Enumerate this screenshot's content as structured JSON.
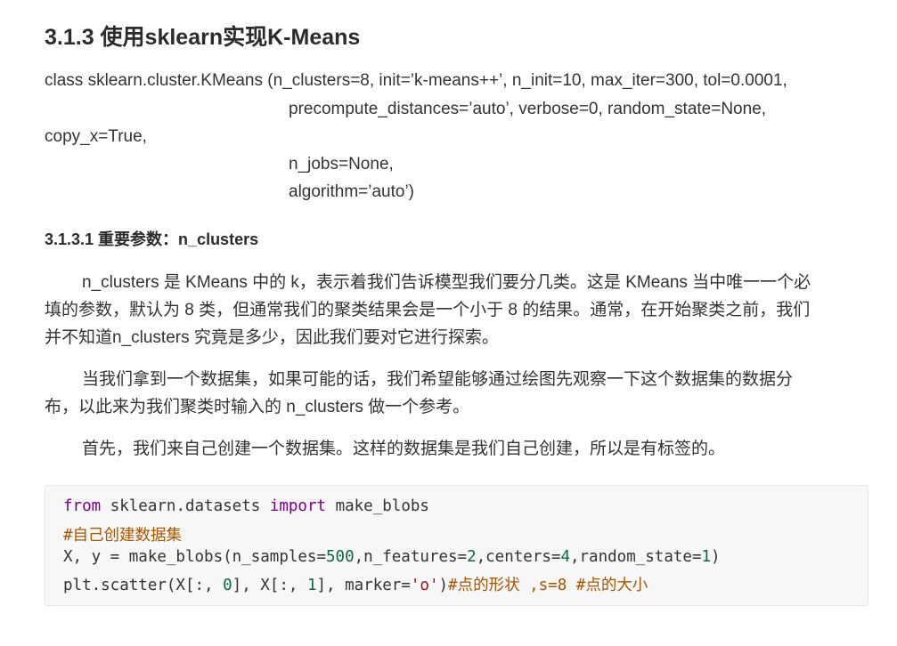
{
  "heading": "3.1.3 使用sklearn实现K-Means",
  "signature": {
    "line1": "class sklearn.cluster.KMeans (n_clusters=8, init=’k-means++’, n_init=10, max_iter=300, tol=0.0001,",
    "line2": "precompute_distances=’auto’, verbose=0, random_state=None,",
    "line3": "copy_x=True,",
    "line4": "n_jobs=None,",
    "line5": "algorithm=’auto’)"
  },
  "subheading": "3.1.3.1 重要参数：n_clusters",
  "paragraphs": {
    "p1": [
      "n_clusters 是 KMeans 中的 k，表示着我们告诉模型我们要分几类。这是 KMeans 当中唯一一个必",
      "填的参数，默认为 8 类，但通常我们的聚类结果会是一个小于 8 的结果。通常，在开始聚类之前，我们",
      "并不知道n_clusters 究竟是多少，因此我们要对它进行探索。"
    ],
    "p2": [
      "当我们拿到一个数据集，如果可能的话，我们希望能够通过绘图先观察一下这个数据集的数据分",
      "布，以此来为我们聚类时输入的 n_clusters 做一个参考。"
    ],
    "p3": [
      "首先，我们来自己创建一个数据集。这样的数据集是我们自己创建，所以是有标签的。"
    ]
  },
  "code": {
    "l1": {
      "kw1": "from",
      "mod": " sklearn.datasets ",
      "kw2": "import",
      "name": " make_blobs"
    },
    "l2": {
      "comment": "#自己创建数据集"
    },
    "l3": {
      "a": "X, y = make_blobs(n_samples=",
      "n1": "500",
      "b": ",n_features=",
      "n2": "2",
      "c": ",centers=",
      "n3": "4",
      "d": ",random_state=",
      "n4": "1",
      "e": ")"
    },
    "l4": {
      "a": "plt.scatter(X[:, ",
      "n1": "0",
      "b": "], X[:, ",
      "n2": "1",
      "c": "], marker=",
      "s1": "'o'",
      "d": ")",
      "comment": "#点的形状 ,s=8 #点的大小"
    }
  }
}
